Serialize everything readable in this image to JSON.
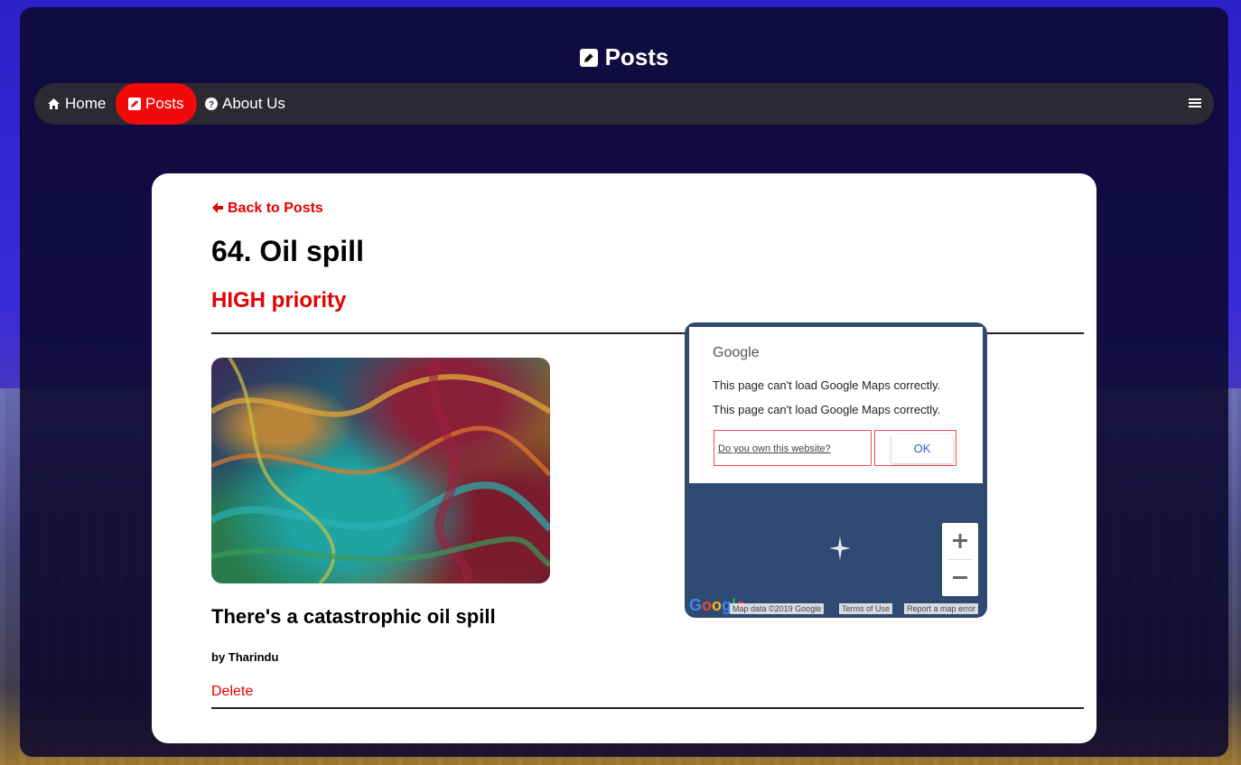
{
  "header": {
    "title": "Posts",
    "title_icon": "edit-icon"
  },
  "nav": {
    "items": [
      {
        "label": "Home",
        "icon": "home-icon",
        "active": false
      },
      {
        "label": "Posts",
        "icon": "edit-icon",
        "active": true
      },
      {
        "label": "About Us",
        "icon": "question-circle-icon",
        "active": false
      }
    ],
    "menu_icon": "hamburger-menu-icon"
  },
  "post": {
    "back_label": "Back to Posts",
    "title": "64. Oil spill",
    "priority": "HIGH priority",
    "headline": "There's a catastrophic oil spill",
    "author": "by Tharindu",
    "delete_label": "Delete"
  },
  "map": {
    "logo_text": "Google",
    "error_message_1": "This page can't load Google Maps correctly.",
    "error_message_2": "This page can't load Google Maps correctly.",
    "own_site_label": "Do you own this website?",
    "ok_label": "OK",
    "footer": {
      "map_data": "Map data ©2019 Google",
      "terms": "Terms of Use",
      "report": "Report a map error"
    }
  },
  "colors": {
    "accent": "#e60000",
    "nav_active": "#f00a0a",
    "navbar_bg": "#2b2a33",
    "map_bg": "#2f4a72"
  }
}
